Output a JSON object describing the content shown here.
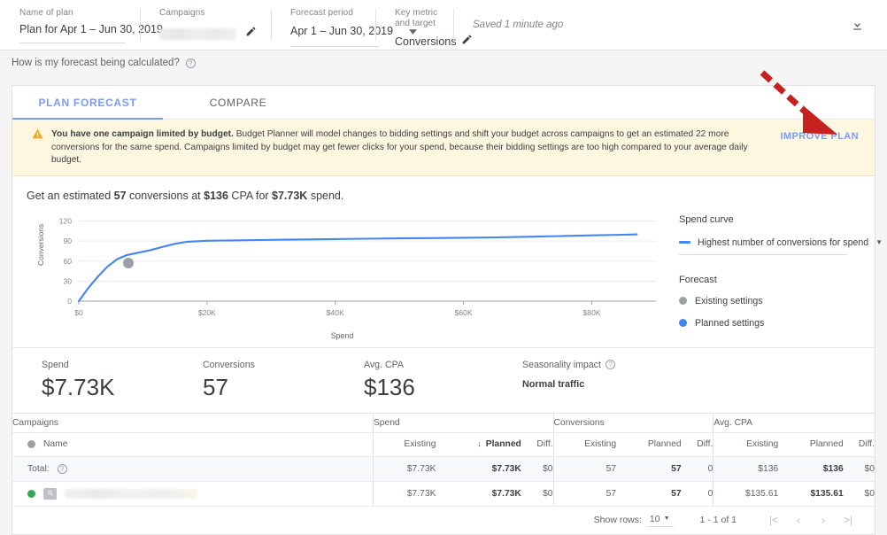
{
  "topbar": {
    "fields": [
      {
        "label": "Name of plan",
        "value": "Plan for Apr 1 – Jun 30, 2019"
      },
      {
        "label": "Campaigns",
        "value": ""
      },
      {
        "label": "Forecast period",
        "value": "Apr 1 – Jun 30, 2019"
      },
      {
        "label": "Key metric and target",
        "value": "Conversions"
      }
    ],
    "saved_status": "Saved 1 minute ago",
    "download_icon": "download-icon",
    "edit_icon": "pencil-edit-icon",
    "dropdown_icon": "chevron-down-icon"
  },
  "subheader": {
    "text": "How is my forecast being calculated?",
    "help_icon": "help-circle-icon"
  },
  "tabs": [
    {
      "label": "PLAN FORECAST",
      "active": true
    },
    {
      "label": "COMPARE",
      "active": false
    }
  ],
  "warning": {
    "icon": "warning-triangle-icon",
    "bold_lead": "You have one campaign limited by budget.",
    "body": " Budget Planner will model changes to bidding settings and shift your budget across campaigns to get an estimated 22 more conversions for the same spend. Campaigns limited by budget may get fewer clicks for your spend, because their bidding settings are too high compared to your average daily budget.",
    "action_label": "IMPROVE PLAN",
    "accent": "#7b9cf3",
    "background": "#fef7e0"
  },
  "estimate": {
    "prefix": "Get an estimated ",
    "conversions": "57",
    "mid1": " conversions at ",
    "cpa": "$136",
    "mid2": " CPA for ",
    "spend": "$7.73K",
    "suffix": " spend."
  },
  "chart_data": {
    "type": "line",
    "title": "",
    "xlabel": "Spend",
    "ylabel": "Conversions",
    "xlim": [
      0,
      90000
    ],
    "ylim": [
      0,
      130
    ],
    "xticks": [
      "$0",
      "$20K",
      "$40K",
      "$60K",
      "$80K"
    ],
    "xtick_values": [
      0,
      20000,
      40000,
      60000,
      80000
    ],
    "yticks": [
      "0",
      "30",
      "60",
      "90",
      "120"
    ],
    "ytick_values": [
      0,
      30,
      60,
      90,
      120
    ],
    "grid": true,
    "legend_position": "right",
    "series": [
      {
        "name": "Highest number of conversions for spend",
        "color": "#4285f4",
        "x": [
          0,
          1500,
          3000,
          4500,
          6000,
          7500,
          9000,
          11000,
          13000,
          15000,
          17000,
          20000,
          24000,
          28000,
          32000,
          36000,
          40000,
          45000,
          50000,
          55000,
          60000,
          65000,
          70000,
          75000,
          80000,
          85000,
          87000
        ],
        "y": [
          0,
          20,
          37,
          52,
          63,
          69,
          72,
          76,
          81,
          86,
          89,
          90.5,
          91,
          91.5,
          92,
          92.5,
          93,
          93.5,
          94,
          94.5,
          95,
          95.5,
          96.5,
          97.5,
          98.5,
          99.5,
          100
        ]
      }
    ],
    "points": [
      {
        "name": "Existing settings",
        "x": 7730,
        "y": 57,
        "color": "#9aa0a6"
      }
    ]
  },
  "side_panel": {
    "spend_curve_title": "Spend curve",
    "spend_curve_option": "Highest number of conversions for spend",
    "forecast_title": "Forecast",
    "legend": [
      {
        "label": "Existing settings",
        "color": "#9aa0a6"
      },
      {
        "label": "Planned settings",
        "color": "#4285f4"
      }
    ]
  },
  "metrics": [
    {
      "label": "Spend",
      "value": "$7.73K"
    },
    {
      "label": "Conversions",
      "value": "57"
    },
    {
      "label": "Avg. CPA",
      "value": "$136"
    }
  ],
  "seasonality": {
    "label": "Seasonality impact",
    "value": "Normal traffic",
    "help_icon": "help-circle-icon"
  },
  "table": {
    "groups": [
      "Campaigns",
      "Spend",
      "Conversions",
      "Avg. CPA"
    ],
    "subheaders": {
      "name": "Name",
      "spend": [
        "Existing",
        "Planned",
        "Diff."
      ],
      "conversions": [
        "Existing",
        "Planned",
        "Diff."
      ],
      "cpa": [
        "Existing",
        "Planned",
        "Diff."
      ]
    },
    "sort_indicator": "↓",
    "rows": [
      {
        "name": "Total:",
        "is_total": true,
        "spend": [
          "$7.73K",
          "$7.73K",
          "$0"
        ],
        "conversions": [
          "57",
          "57",
          "0"
        ],
        "cpa": [
          "$136",
          "$136",
          "$0"
        ]
      },
      {
        "name": "",
        "is_total": false,
        "spend": [
          "$7.73K",
          "$7.73K",
          "$0"
        ],
        "conversions": [
          "57",
          "57",
          "0"
        ],
        "cpa": [
          "$135.61",
          "$135.61",
          "$0"
        ]
      }
    ]
  },
  "pagination": {
    "show_rows_label": "Show rows:",
    "rows_value": "10",
    "range": "1 - 1 of 1",
    "first_icon": "|<",
    "prev_icon": "‹",
    "next_icon": "›",
    "last_icon": ">|"
  },
  "annotation": {
    "type": "red-dashed-arrow",
    "color": "#c5221f",
    "points_to": "IMPROVE PLAN"
  }
}
